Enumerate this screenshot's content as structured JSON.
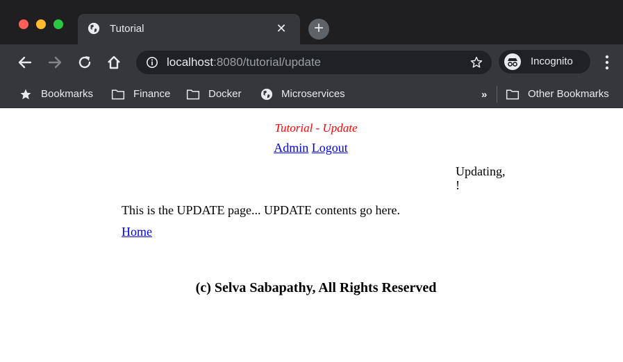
{
  "browser": {
    "tab": {
      "title": "Tutorial",
      "icon": "globe-icon"
    },
    "toolbar": {
      "url_host": "localhost",
      "url_rest": ":8080/tutorial/update",
      "profile_label": "Incognito"
    },
    "bookmarks": {
      "items": [
        {
          "label": "Bookmarks",
          "icon": "star-icon"
        },
        {
          "label": "Finance",
          "icon": "folder-icon"
        },
        {
          "label": "Docker",
          "icon": "folder-icon"
        },
        {
          "label": "Microservices",
          "icon": "globe-icon"
        }
      ],
      "overflow": "»",
      "other": "Other Bookmarks"
    },
    "colors": {
      "frame": "#1f1f21",
      "toolbar": "#36373a",
      "omnibox": "#202124",
      "text": "#e8eaed"
    }
  },
  "page": {
    "title": "Tutorial - Update",
    "nav": {
      "admin": "Admin",
      "logout": "Logout"
    },
    "greeting_line1": "Updating,",
    "greeting_line2": "!",
    "content": "This is the UPDATE page... UPDATE contents go here.",
    "home": "Home",
    "footer": "(c) Selva Sabapathy, All Rights Reserved",
    "colors": {
      "title": "#ff0000",
      "link": "#0000ee"
    }
  }
}
